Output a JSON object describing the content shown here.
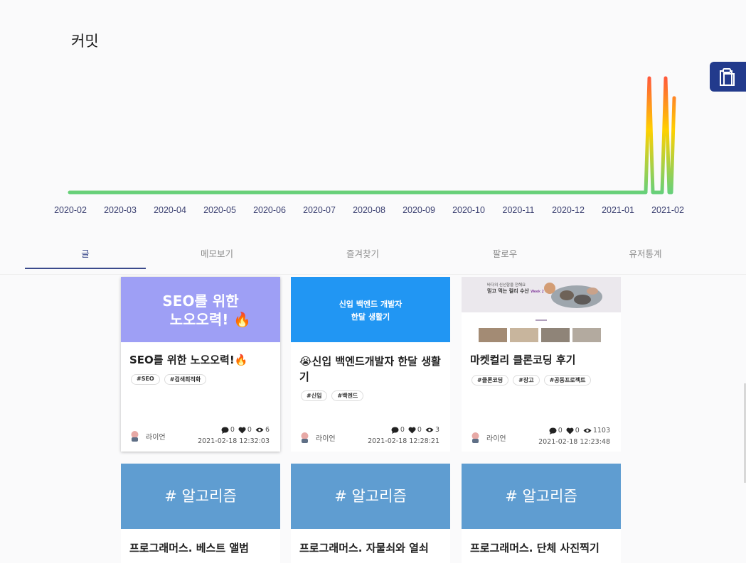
{
  "commit": {
    "title": "커밋",
    "ticks": [
      "2020-02",
      "2020-03",
      "2020-04",
      "2020-05",
      "2020-06",
      "2020-07",
      "2020-08",
      "2020-09",
      "2020-10",
      "2020-11",
      "2020-12",
      "2021-01",
      "2021-02"
    ]
  },
  "tabs": [
    "글",
    "메모보기",
    "즐겨찾기",
    "팔로우",
    "유저통계"
  ],
  "posts": [
    {
      "thumb_line1": "SEO를 위한",
      "thumb_line2": "노오오력! 🔥",
      "title": "SEO를 위한 노오오력!🔥",
      "tags": [
        "#SEO",
        "#검색최적화"
      ],
      "author": "라이언",
      "comments": "0",
      "likes": "0",
      "views": "6",
      "date": "2021-02-18 12:32:03"
    },
    {
      "thumb_line1": "신입 백엔드 개발자",
      "thumb_line2": "한달 생활기",
      "title_line1": "😭신입 백엔드개발자 한달 생활",
      "title_line2": "기",
      "tags": [
        "#신입",
        "#백엔드"
      ],
      "author": "라이언",
      "comments": "0",
      "likes": "0",
      "views": "3",
      "date": "2021-02-18 12:28:21"
    },
    {
      "thumb_line1": "바다의 신선함을 전해요",
      "thumb_line2": "믿고 먹는 컬리 수산",
      "thumb_badge": "Week 2",
      "title": "마켓컬리 클론코딩 후기",
      "tags": [
        "#클론코딩",
        "#장고",
        "#공동프로젝트"
      ],
      "author": "라이언",
      "comments": "0",
      "likes": "0",
      "views": "1103",
      "date": "2021-02-18 12:23:48"
    }
  ],
  "algo_posts": [
    {
      "thumb": "# 알고리즘",
      "title": "프로그래머스. 베스트 앨범"
    },
    {
      "thumb": "# 알고리즘",
      "title": "프로그래머스. 자물쇠와 열쇠"
    },
    {
      "thumb": "# 알고리즘",
      "title": "프로그래머스. 단체 사진찍기"
    }
  ],
  "colors": {
    "accent": "#3b4a8c",
    "clip_button": "#223a8c",
    "seo_thumb": "#9e9ff5",
    "backend_thumb": "#2196f3",
    "algo_thumb": "#5f9dd1"
  },
  "icons": [
    "clipboard-icon",
    "comment-icon",
    "heart-icon",
    "eye-icon"
  ]
}
